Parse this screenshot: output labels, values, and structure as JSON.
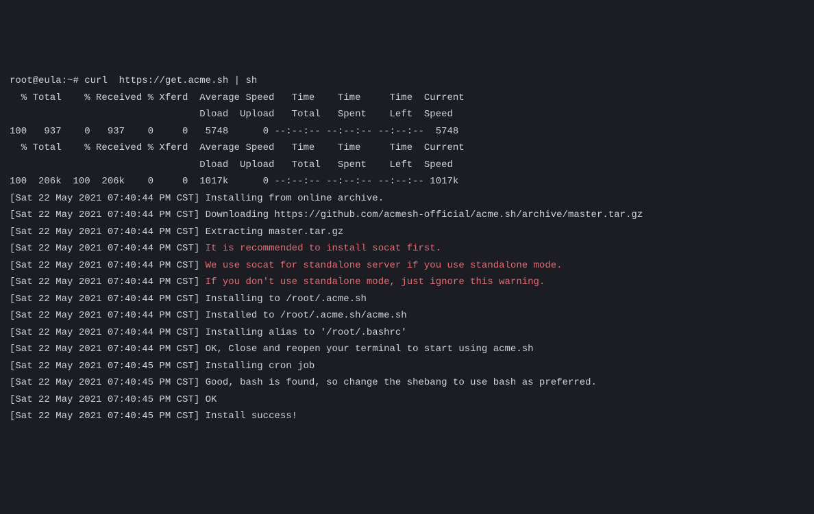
{
  "prompt": {
    "user_host": "root@eula",
    "sep": ":",
    "path": "~",
    "symbol": "#",
    "command": "curl  https://get.acme.sh | sh"
  },
  "curl_header1_line1": "  % Total    % Received % Xferd  Average Speed   Time    Time     Time  Current",
  "curl_header1_line2": "                                 Dload  Upload   Total   Spent    Left  Speed",
  "curl_progress1": "100   937    0   937    0     0   5748      0 --:--:-- --:--:-- --:--:--  5748",
  "curl_header2_line1": "  % Total    % Received % Xferd  Average Speed   Time    Time     Time  Current",
  "curl_header2_line2": "                                 Dload  Upload   Total   Spent    Left  Speed",
  "curl_progress2": "100  206k  100  206k    0     0  1017k      0 --:--:-- --:--:-- --:--:-- 1017k",
  "ts44": "[Sat 22 May 2021 07:40:44 PM CST] ",
  "ts45": "[Sat 22 May 2021 07:40:45 PM CST] ",
  "msg": {
    "m1": "Installing from online archive.",
    "m2": "Downloading https://github.com/acmesh-official/acme.sh/archive/master.tar.gz",
    "m3": "Extracting master.tar.gz",
    "w1": "It is recommended to install socat first.",
    "w2": "We use socat for standalone server if you use standalone mode.",
    "w3": "If you don't use standalone mode, just ignore this warning.",
    "m4": "Installing to /root/.acme.sh",
    "m5": "Installed to /root/.acme.sh/acme.sh",
    "m6": "Installing alias to '/root/.bashrc'",
    "m7": "OK, Close and reopen your terminal to start using acme.sh",
    "m8": "Installing cron job",
    "m9": "Good, bash is found, so change the shebang to use bash as preferred.",
    "m10": "OK",
    "m11": "Install success!"
  }
}
